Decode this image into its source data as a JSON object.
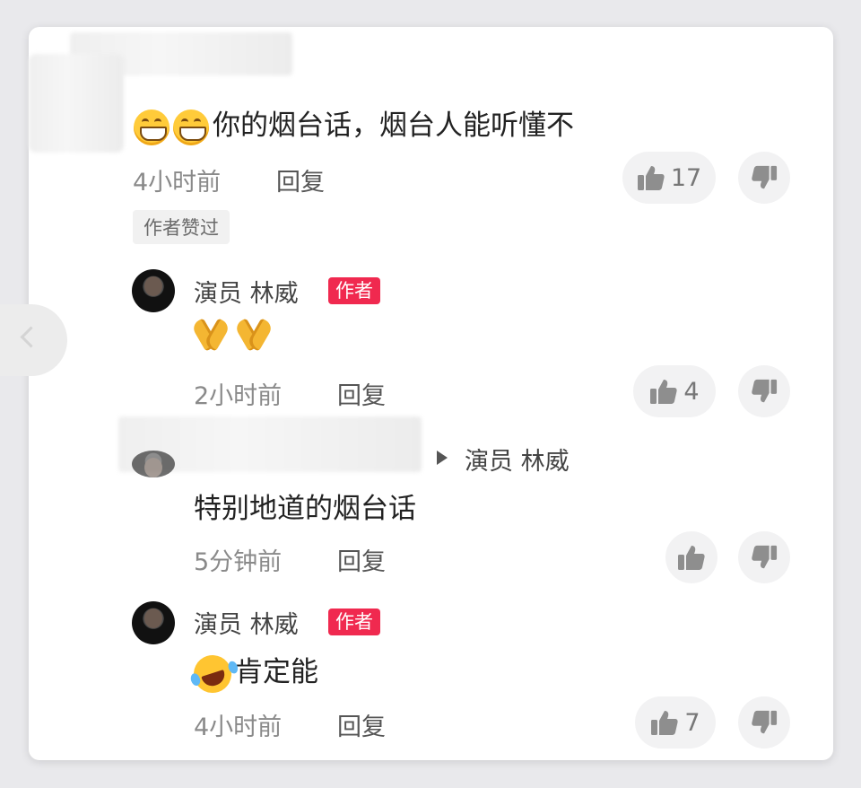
{
  "comment1": {
    "text": "你的烟台话，烟台人能听懂不",
    "time": "4小时前",
    "reply": "回复",
    "likes": "17",
    "author_liked": "作者赞过"
  },
  "reply1": {
    "username": "演员 林威",
    "badge": "作者",
    "time": "2小时前",
    "reply": "回复",
    "likes": "4"
  },
  "reply2": {
    "target": "演员 林威",
    "text": "特别地道的烟台话",
    "time": "5分钟前",
    "reply": "回复"
  },
  "reply3": {
    "username": "演员 林威",
    "badge": "作者",
    "text": "肯定能",
    "time": "4小时前",
    "reply": "回复",
    "likes": "7"
  },
  "icons": {
    "like": "thumbs-up-icon",
    "dislike": "thumbs-down-icon",
    "back": "chevron-left-icon"
  }
}
